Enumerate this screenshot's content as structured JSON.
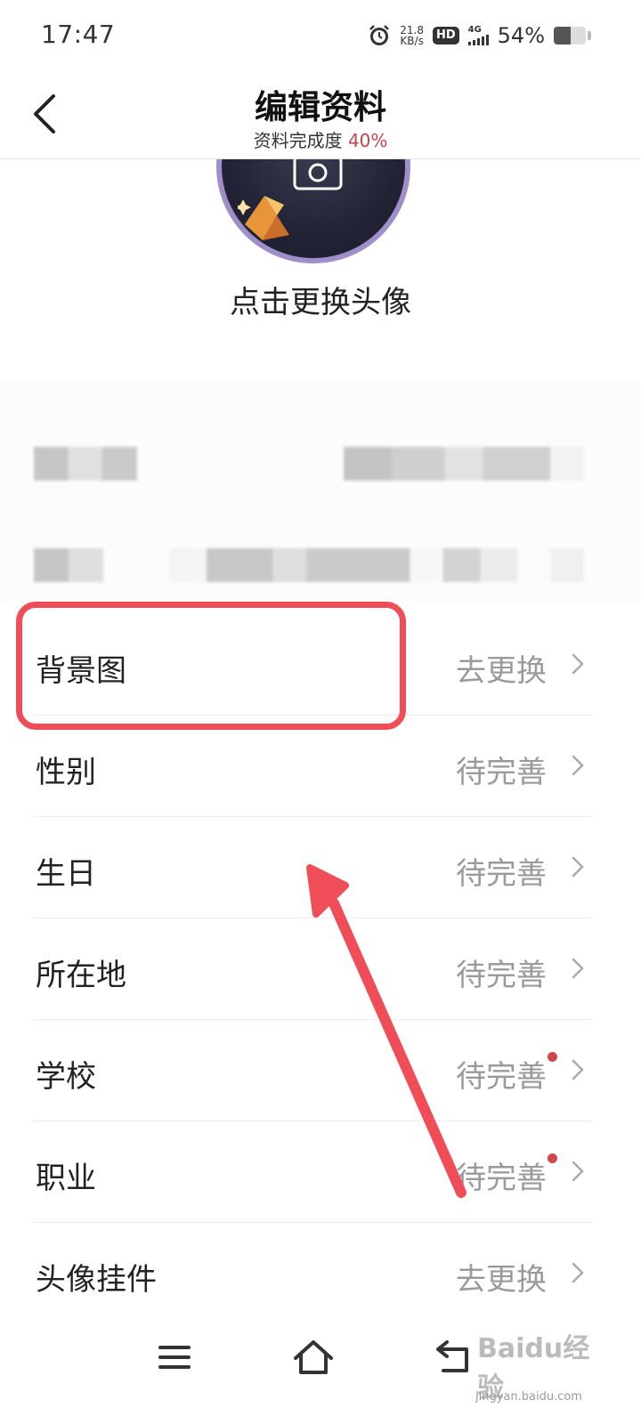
{
  "status_bar": {
    "time": "17:47",
    "net_speed_value": "21.8",
    "net_speed_unit": "KB/s",
    "hd_badge": "HD",
    "network": "4G",
    "battery_percent": "54%",
    "battery_level": 0.54,
    "icons": [
      "alarm-icon",
      "signal-icon",
      "battery-icon"
    ]
  },
  "header": {
    "title": "编辑资料",
    "completion_label": "资料完成度",
    "completion_value": "40%"
  },
  "avatar": {
    "change_label": "点击更换头像",
    "ring_color": "#9f8ec9"
  },
  "settings": [
    {
      "label": "背景图",
      "value": "去更换",
      "dot": false
    },
    {
      "label": "性别",
      "value": "待完善",
      "dot": false
    },
    {
      "label": "生日",
      "value": "待完善",
      "dot": false
    },
    {
      "label": "所在地",
      "value": "待完善",
      "dot": false
    },
    {
      "label": "学校",
      "value": "待完善",
      "dot": true
    },
    {
      "label": "职业",
      "value": "待完善",
      "dot": true
    },
    {
      "label": "头像挂件",
      "value": "去更换",
      "dot": false
    }
  ],
  "annotation": {
    "highlight_color": "#ef4d57",
    "arrow_color": "#ef4d57"
  },
  "watermark": {
    "text": "Baidu经验",
    "url_text": "jingyan.baidu.com"
  },
  "colors": {
    "accent": "#c0464b",
    "dot": "#d0484d",
    "muted_text": "#9a9a9a"
  }
}
